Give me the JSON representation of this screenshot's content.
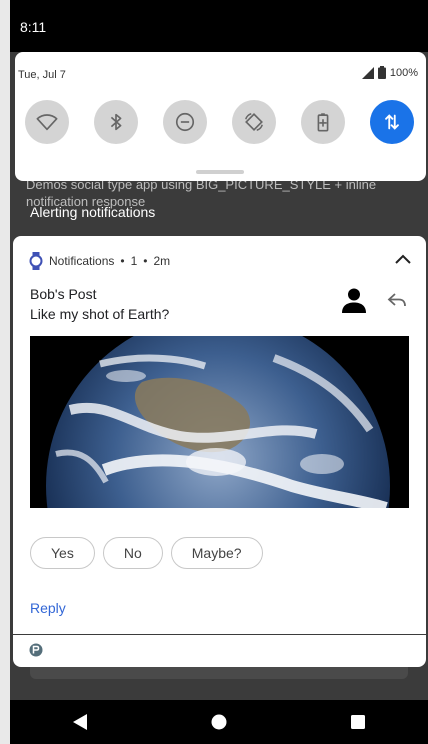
{
  "status_bar": {
    "time": "8:11"
  },
  "quick_settings": {
    "date": "Tue, Jul 7",
    "battery_percent": "100%",
    "tiles": [
      {
        "name": "wifi",
        "active": false
      },
      {
        "name": "bluetooth",
        "active": false
      },
      {
        "name": "do-not-disturb",
        "active": false
      },
      {
        "name": "auto-rotate",
        "active": false
      },
      {
        "name": "battery-saver",
        "active": false
      },
      {
        "name": "mobile-data",
        "active": true
      }
    ]
  },
  "background_text": "Demos social type app using BIG_PICTURE_STYLE + inline notification response",
  "section_header": "Alerting notifications",
  "notification": {
    "app_name": "Notifications",
    "count": "1",
    "age": "2m",
    "title": "Bob's Post",
    "text": "Like my shot of Earth?",
    "actions": [
      "Yes",
      "No",
      "Maybe?"
    ],
    "reply_label": "Reply"
  },
  "colors": {
    "accent": "#1a73e8",
    "reply": "#3367d6",
    "watch_icon": "#3f51b5"
  }
}
